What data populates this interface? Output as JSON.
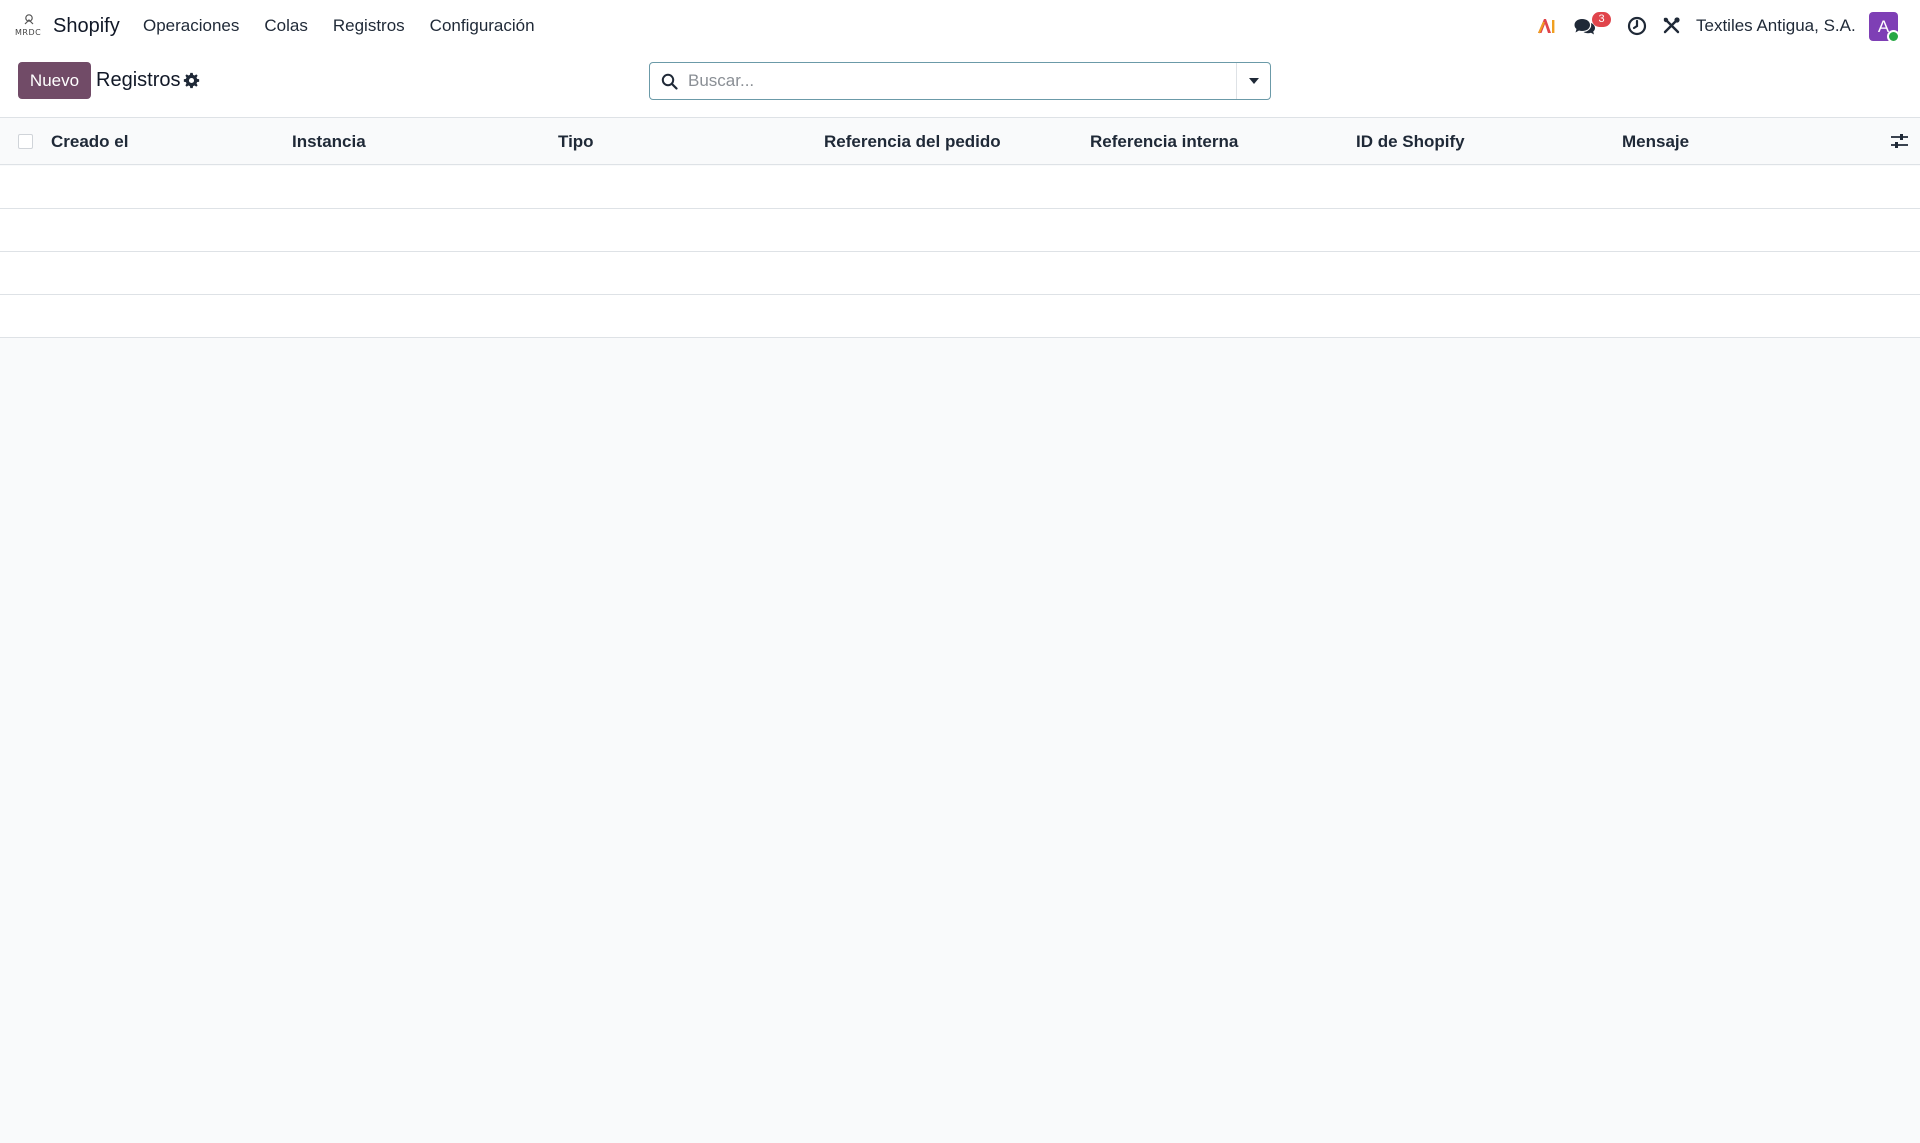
{
  "navbar": {
    "brand": "Shopify",
    "menu": [
      "Operaciones",
      "Colas",
      "Registros",
      "Configuración"
    ],
    "message_count": "3",
    "company": "Textiles Antigua, S.A.",
    "avatar_initial": "A",
    "icons": [
      "ai-icon",
      "chat-icon",
      "clock-icon",
      "tools-icon"
    ]
  },
  "control_panel": {
    "new_button": "Nuevo",
    "title": "Registros",
    "search_placeholder": "Buscar..."
  },
  "list": {
    "columns": [
      "Creado el",
      "Instancia",
      "Tipo",
      "Referencia del pedido",
      "Referencia interna",
      "ID de Shopify",
      "Mensaje"
    ],
    "rows": []
  },
  "colors": {
    "primary": "#714b67",
    "avatar": "#7e3fb5",
    "badge": "#e0444b"
  }
}
